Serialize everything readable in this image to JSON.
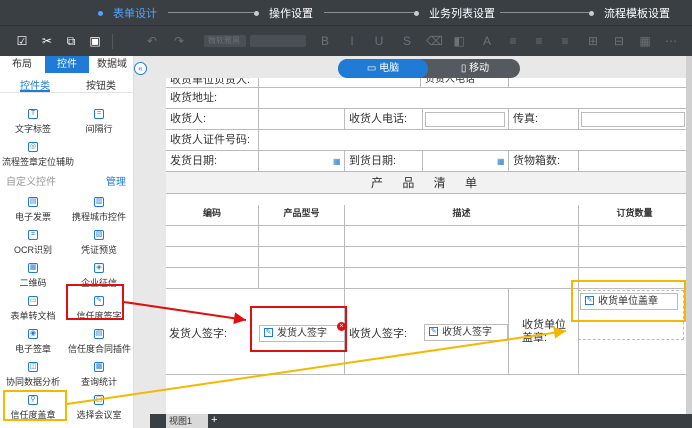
{
  "steps": [
    {
      "label": "表单设计",
      "active": true
    },
    {
      "label": "操作设置",
      "active": false
    },
    {
      "label": "业务列表设置",
      "active": false
    },
    {
      "label": "流程模板设置",
      "active": false
    }
  ],
  "toolbar": {
    "icons": [
      "check-square-icon",
      "scissors-icon",
      "copy-icon",
      "paste-icon",
      "undo-icon",
      "redo-icon",
      "font-size-icon",
      "bold-icon",
      "italic-icon",
      "underline-icon",
      "strikethrough-icon",
      "clear-icon",
      "align-icon"
    ],
    "font_select": "微软雅黑"
  },
  "left_panel": {
    "tabs": [
      "布局",
      "控件",
      "数据域"
    ],
    "subtabs": [
      "控件类",
      "按钮类"
    ],
    "controls_top": [
      {
        "label": "文字标签"
      },
      {
        "label": "间隔行"
      },
      {
        "label": "流程签章定位辅助"
      }
    ],
    "section_custom": "自定义控件",
    "manage": "管理",
    "controls_custom": [
      {
        "label": "电子发票"
      },
      {
        "label": "携程城市控件"
      },
      {
        "label": "OCR识别"
      },
      {
        "label": "凭证预览"
      },
      {
        "label": "二维码"
      },
      {
        "label": "企业征信"
      },
      {
        "label": "表单转文档"
      },
      {
        "label": "信任度签字"
      },
      {
        "label": "电子签章"
      },
      {
        "label": "信任度合同插件"
      },
      {
        "label": "协同数据分析"
      },
      {
        "label": "查询统计"
      },
      {
        "label": "信任度盖章"
      },
      {
        "label": "选择会议室"
      }
    ]
  },
  "device_switch": {
    "desktop": "电脑",
    "mobile": "移动"
  },
  "form": {
    "row1": {
      "a": "收货单位负责人:",
      "b": "负责人电话"
    },
    "row2": {
      "a": "收货地址:"
    },
    "row3": {
      "a": "收货人:",
      "b": "收货人电话:",
      "c": "传真:"
    },
    "row4": {
      "a": "收货人证件号码:"
    },
    "row5": {
      "a": "发货日期:",
      "b": "到货日期:",
      "c": "货物箱数:"
    },
    "product_title": "产 品 清 单",
    "table_headers": [
      "编码",
      "产品型号",
      "描述",
      "订货数量"
    ],
    "sign": {
      "shipper_label": "发货人签字:",
      "shipper_chip": "发货人签字",
      "receiver_label": "收货人签字:",
      "receiver_chip": "收货人签字",
      "unit_label": "收货单位\n盖章:",
      "unit_chip": "收货单位盖章"
    }
  },
  "bottom": {
    "sheet_tab": "视图1",
    "add": "+"
  }
}
